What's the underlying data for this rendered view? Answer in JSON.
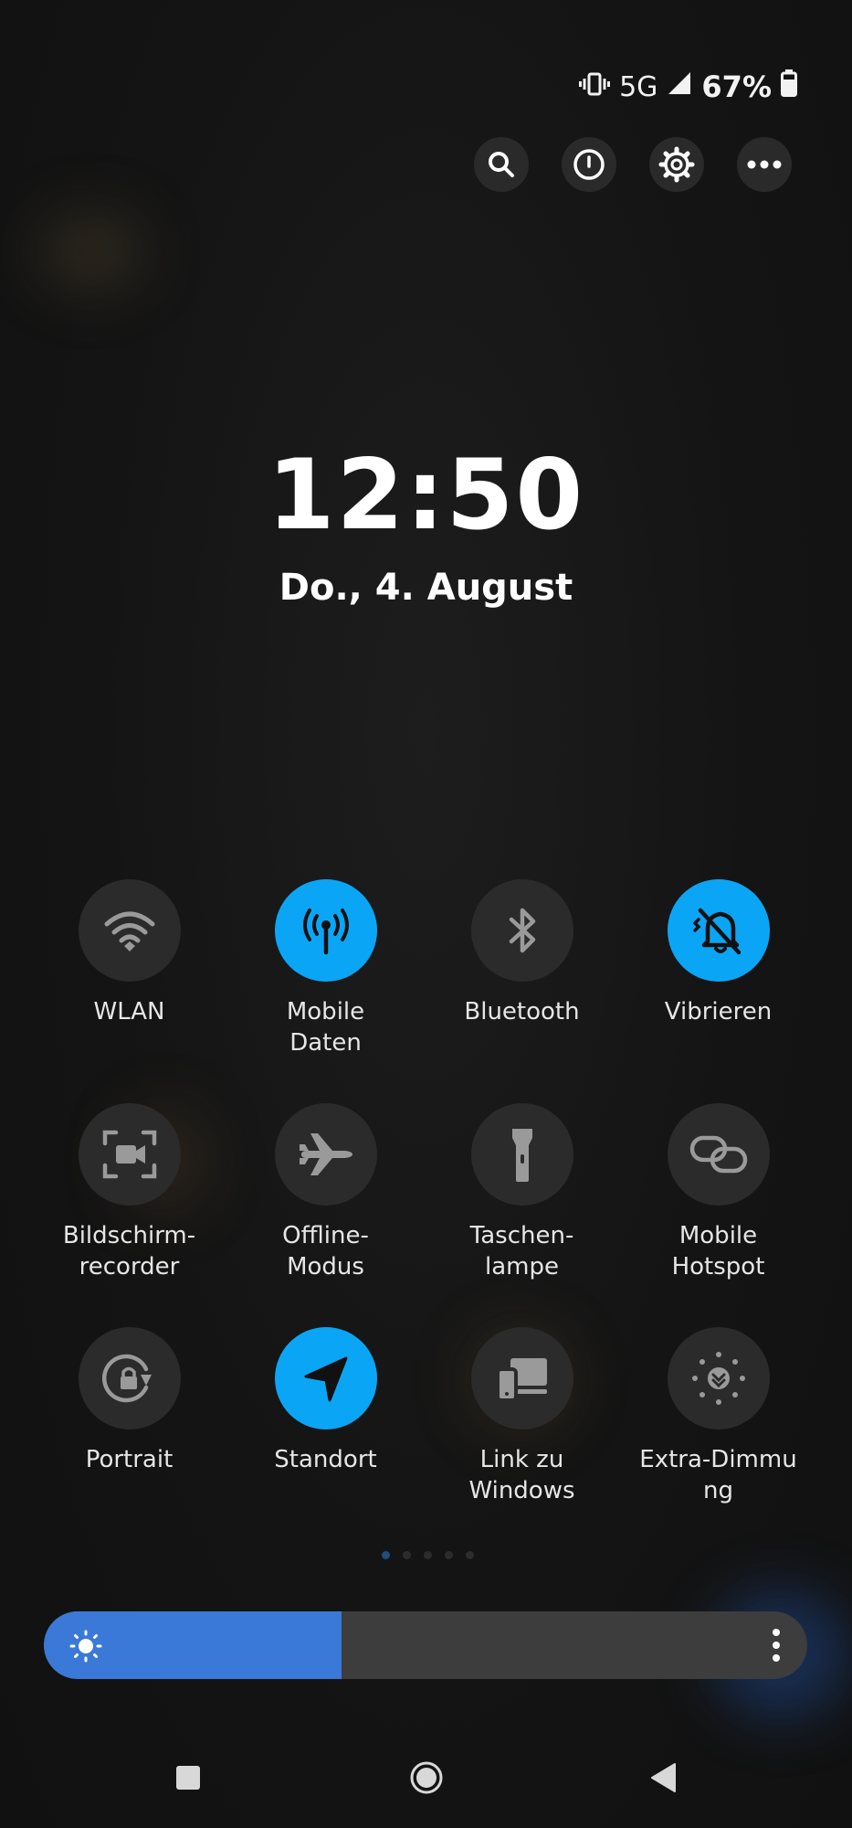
{
  "status_bar": {
    "network": "5G",
    "battery_percent": "67%",
    "icons": [
      "vibrate-icon",
      "signal-icon",
      "battery-icon"
    ]
  },
  "top_actions": [
    {
      "name": "search-icon"
    },
    {
      "name": "power-icon"
    },
    {
      "name": "gear-icon"
    },
    {
      "name": "more-horizontal-icon"
    }
  ],
  "clock": {
    "time": "12:50",
    "date": "Do., 4. August"
  },
  "colors": {
    "accent": "#0aa6f5",
    "tile_inactive": "#2b2b2b",
    "brightness_fill": "#3a79d8",
    "brightness_track": "#3d3d3d"
  },
  "tiles": [
    {
      "label": "WLAN",
      "icon": "wifi-icon",
      "active": false
    },
    {
      "label": "Mobile\nDaten",
      "icon": "mobile-data-icon",
      "active": true
    },
    {
      "label": "Bluetooth",
      "icon": "bluetooth-icon",
      "active": false
    },
    {
      "label": "Vibrieren",
      "icon": "vibrate-bell-icon",
      "active": true
    },
    {
      "label": "Bildschirm-\nrecorder",
      "icon": "screen-recorder-icon",
      "active": false
    },
    {
      "label": "Offline-\nModus",
      "icon": "airplane-icon",
      "active": false
    },
    {
      "label": "Taschen-\nlampe",
      "icon": "flashlight-icon",
      "active": false
    },
    {
      "label": "Mobile\nHotspot",
      "icon": "hotspot-icon",
      "active": false
    },
    {
      "label": "Portrait",
      "icon": "rotation-lock-icon",
      "active": false
    },
    {
      "label": "Standort",
      "icon": "location-icon",
      "active": true
    },
    {
      "label": "Link zu\nWindows",
      "icon": "link-to-windows-icon",
      "active": false
    },
    {
      "label": "Extra-Dimmu\nng",
      "icon": "extra-dim-icon",
      "active": false
    }
  ],
  "page_indicator": {
    "total": 5,
    "current": 1
  },
  "brightness": {
    "level": 0.39,
    "icons": [
      "sun-icon",
      "more-vertical-icon"
    ]
  },
  "nav_bar": {
    "buttons": [
      "recents-button",
      "home-button",
      "back-button"
    ]
  }
}
